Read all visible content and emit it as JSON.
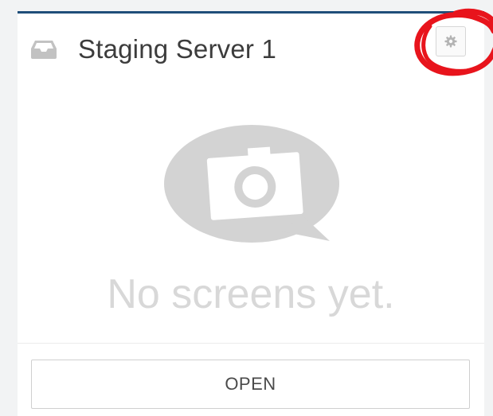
{
  "card": {
    "title": "Staging Server 1",
    "icon": "inbox-tray-icon",
    "settings_icon": "gear-icon",
    "accent_color": "#1f4e79"
  },
  "empty_state": {
    "icon": "camera-speech-bubble-icon",
    "message": "No screens yet."
  },
  "footer": {
    "open_label": "OPEN"
  },
  "annotation": {
    "type": "hand-drawn circle around settings button",
    "color": "#e8141c"
  }
}
